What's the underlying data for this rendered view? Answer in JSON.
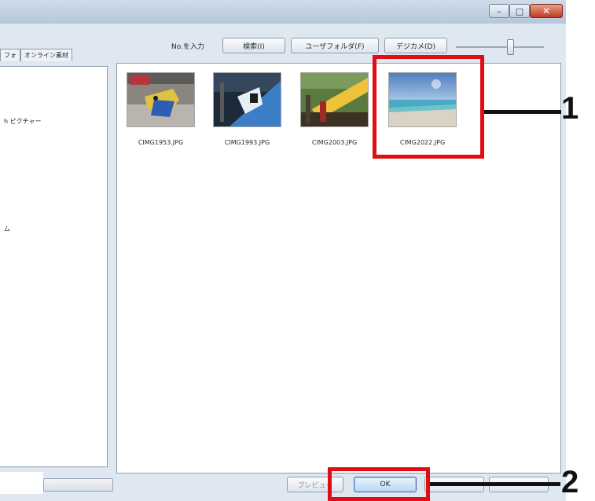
{
  "toolbar": {
    "no_input_label": "No.を入力",
    "search_button": "検索(I)",
    "user_folder_button": "ユーザフォルダ(F)",
    "digital_camera_button": "デジカメ(D)"
  },
  "left_panel": {
    "tabs": [
      "フォ",
      "オンライン素材"
    ],
    "items": [
      "h ピクチャー",
      "ム"
    ]
  },
  "thumbnails": [
    {
      "filename": "CIMG1953.JPG"
    },
    {
      "filename": "CIMG1993.JPG"
    },
    {
      "filename": "CIMG2003.JPG"
    },
    {
      "filename": "CIMG2022.JPG",
      "highlighted": true
    }
  ],
  "buttons": {
    "preview": "プレビュー",
    "ok": "OK"
  },
  "callouts": {
    "step1": "1",
    "step2": "2"
  },
  "colors": {
    "highlight": "#e00d13",
    "ok_border": "#3f6fb3"
  }
}
